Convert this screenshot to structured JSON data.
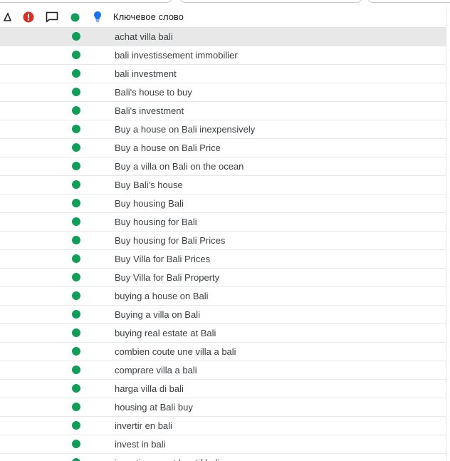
{
  "header": {
    "column_keyword": "Ключевое слово",
    "icons": [
      "triangle-icon",
      "error-icon",
      "comment-icon",
      "status-dot-icon",
      "lightbulb-icon"
    ]
  },
  "colors": {
    "status_green": "#0f9d58",
    "error_red": "#d93025",
    "bulb_blue": "#1a73e8",
    "selected_row": "#e8e8e8"
  },
  "rows": [
    {
      "keyword": "achat villa bali",
      "selected": true
    },
    {
      "keyword": "bali investissement immobilier"
    },
    {
      "keyword": "bali investment"
    },
    {
      "keyword": "Bali's house to buy"
    },
    {
      "keyword": "Bali's investment"
    },
    {
      "keyword": "Buy a house on Bali inexpensively"
    },
    {
      "keyword": "Buy a house on Bali Price"
    },
    {
      "keyword": "Buy a villa on Bali on the ocean"
    },
    {
      "keyword": "Buy Bali's house"
    },
    {
      "keyword": "Buy housing Bali"
    },
    {
      "keyword": "Buy housing for Bali"
    },
    {
      "keyword": "Buy housing for Bali Prices"
    },
    {
      "keyword": "Buy Villa for Bali Prices"
    },
    {
      "keyword": "Buy Villa for Bali Property"
    },
    {
      "keyword": "buying a house on Bali"
    },
    {
      "keyword": "Buying a villa on Bali"
    },
    {
      "keyword": "buying real estate at Bali"
    },
    {
      "keyword": "combien coute une villa a bali"
    },
    {
      "keyword": "comprare villa a bali"
    },
    {
      "keyword": "harga villa di bali"
    },
    {
      "keyword": "housing at Bali buy"
    },
    {
      "keyword": "invertir en bali"
    },
    {
      "keyword": "invest in bali"
    },
    {
      "keyword": "investissement locatif bali"
    }
  ]
}
